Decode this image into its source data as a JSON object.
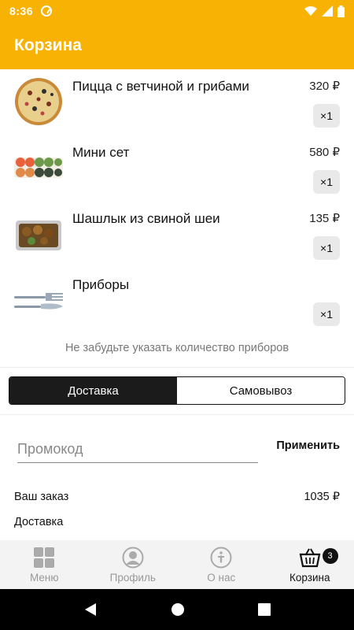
{
  "status": {
    "time": "8:36"
  },
  "appbar": {
    "title": "Корзина"
  },
  "items": [
    {
      "name": "Пицца с ветчиной и грибами",
      "price": "320 ₽",
      "qty": "×1",
      "icon": "pizza-image"
    },
    {
      "name": "Мини сет",
      "price": "580 ₽",
      "qty": "×1",
      "icon": "sushi-set-image"
    },
    {
      "name": "Шашлык из свиной шеи",
      "price": "135 ₽",
      "qty": "×1",
      "icon": "shashlik-image"
    },
    {
      "name": "Приборы",
      "price": "",
      "qty": "×1",
      "icon": "cutlery-image"
    }
  ],
  "hint": "Не забудьте указать количество приборов",
  "delivery": {
    "options": [
      "Доставка",
      "Самовывоз"
    ],
    "selected": "Доставка"
  },
  "promo": {
    "placeholder": "Промокод",
    "apply_label": "Применить"
  },
  "summary": {
    "order_label": "Ваш заказ",
    "order_value": "1035 ₽",
    "delivery_label": "Доставка"
  },
  "nav": {
    "items": [
      {
        "label": "Меню",
        "icon": "menu-grid-icon"
      },
      {
        "label": "Профиль",
        "icon": "profile-icon"
      },
      {
        "label": "О нас",
        "icon": "info-icon"
      },
      {
        "label": "Корзина",
        "icon": "basket-icon"
      }
    ],
    "active": "Корзина",
    "cart_badge": "3"
  },
  "colors": {
    "accent": "#f8b203",
    "dark": "#1b1b1b"
  }
}
